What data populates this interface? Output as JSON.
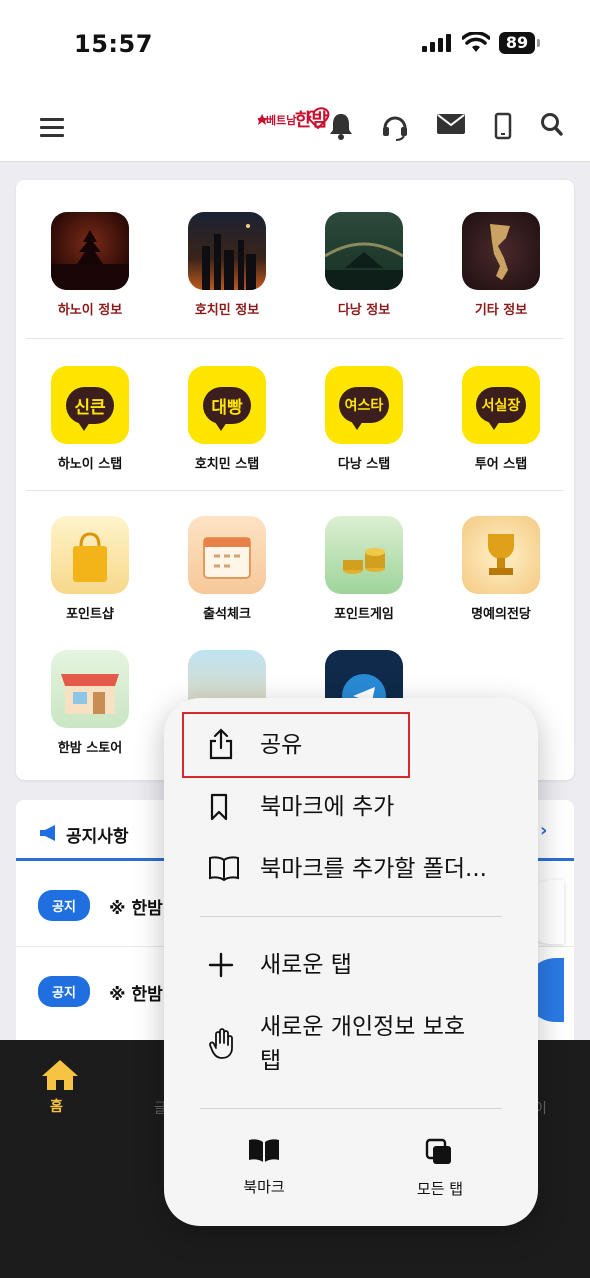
{
  "status_bar": {
    "time": "15:57",
    "battery": "89"
  },
  "header": {
    "logo_small": "베트남",
    "logo_big": "한밤"
  },
  "grid": {
    "row1": [
      "하노이 정보",
      "호치민 정보",
      "다낭 정보",
      "기타 정보"
    ],
    "row2": [
      "하노이 스탭",
      "호치민 스탭",
      "다낭 스탭",
      "투어 스탭"
    ],
    "row2_badges": [
      "신큰",
      "대빵",
      "여스타",
      "서실장"
    ],
    "row3": [
      "포인트샵",
      "출석체크",
      "포인트게임",
      "명예의전당"
    ],
    "row4": [
      "한밤 스토어"
    ]
  },
  "notice": {
    "title": "공지사항",
    "rows": [
      {
        "badge": "공지",
        "text": "※ 한밤"
      },
      {
        "badge": "공지",
        "text": "※ 한밤"
      }
    ]
  },
  "bottom_nav": {
    "home": "홈",
    "ghost_left": "글",
    "ghost_right": "이"
  },
  "menu": {
    "share": "공유",
    "add_bookmark": "북마크에 추가",
    "add_bookmark_folder": "북마크를 추가할 폴더...",
    "new_tab": "새로운 탭",
    "new_private_tab_line1": "새로운 개인정보 보호",
    "new_private_tab_line2": "탭",
    "bookmarks": "북마크",
    "all_tabs": "모든 탭"
  },
  "colors": {
    "accent_blue": "#1f6fe0",
    "kakao_yellow": "#fee500",
    "home_active": "#f6c343",
    "highlight_red": "#d42b2b"
  }
}
